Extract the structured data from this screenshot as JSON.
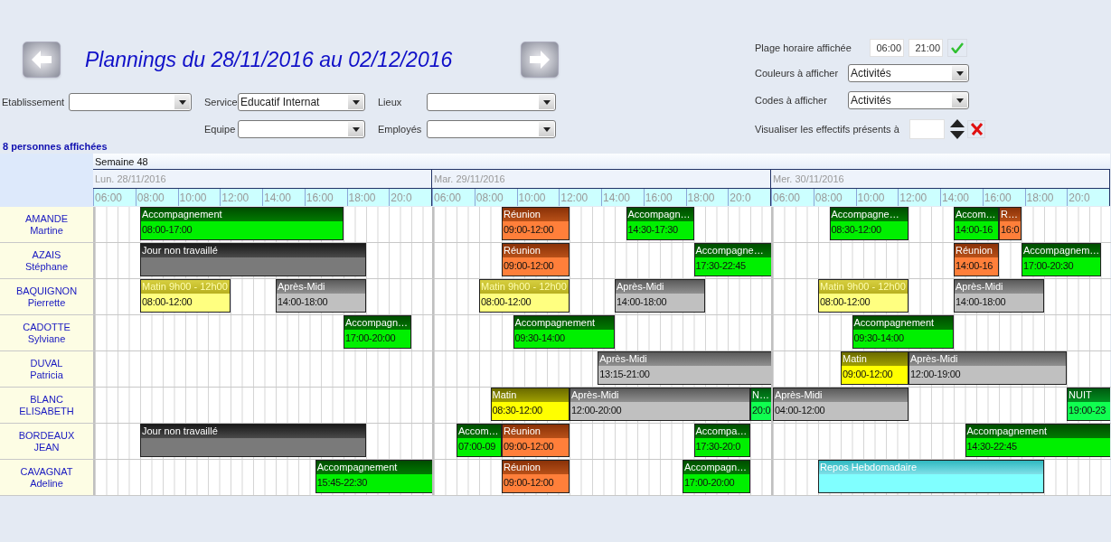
{
  "title": "Plannings du 28/11/2016 au 02/12/2016",
  "filter_rows": [
    [
      {
        "label": "Etablissement"
      },
      {
        "label": "Service",
        "value": "Educatif Internat"
      },
      {
        "label": "Lieux"
      }
    ],
    [
      {
        "label": "Equipe"
      },
      {
        "label": "Employés"
      }
    ]
  ],
  "count_label": "8 personnes affichées",
  "time_range": {
    "label": "Plage horaire affichée",
    "from": "06:00",
    "to": "21:00"
  },
  "colors_select": {
    "label": "Couleurs à afficher",
    "value": "Activités"
  },
  "codes_select": {
    "label": "Codes à afficher",
    "value": "Activités"
  },
  "presence": {
    "label": "Visualiser les effectifs présents à"
  },
  "week": "Semaine 48",
  "days": [
    {
      "label": "Lun. 28/11/2016",
      "hours": [
        "06:00",
        "08:00",
        "10:00",
        "12:00",
        "14:00",
        "16:00",
        "18:00",
        "20:0"
      ]
    },
    {
      "label": "Mar. 29/11/2016",
      "hours": [
        "06:00",
        "08:00",
        "10:00",
        "12:00",
        "14:00",
        "16:00",
        "18:00",
        "20:0"
      ]
    },
    {
      "label": "Mer. 30/11/2016",
      "hours": [
        "06:00",
        "08:00",
        "10:00",
        "12:00",
        "14:00",
        "16:00",
        "18:00",
        "20:0"
      ]
    }
  ],
  "employees": [
    {
      "last": "AMANDE",
      "first": "Martine",
      "mon": [
        {
          "kind": "accompagnement",
          "title": "Accompagnement",
          "time": "08:00-17:00"
        }
      ],
      "tue": [
        {
          "kind": "reunion",
          "title": "Réunion",
          "time": "09:00-12:00"
        },
        {
          "kind": "accompagnement",
          "title": "Accompagn…",
          "time": "14:30-17:30"
        }
      ],
      "wed": [
        {
          "kind": "accompagnement",
          "title": "Accompagne…",
          "time": "08:30-12:00"
        },
        {
          "kind": "accompagnement",
          "title": "Accom…",
          "time": "14:00-16"
        },
        {
          "kind": "reunion",
          "title": "R…",
          "time": "16:0"
        }
      ]
    },
    {
      "last": "AZAIS",
      "first": "Stéphane",
      "mon": [
        {
          "kind": "off",
          "title": "Jour non travaillé"
        }
      ],
      "tue": [
        {
          "kind": "reunion",
          "title": "Réunion",
          "time": "09:00-12:00"
        },
        {
          "kind": "accompagnement",
          "title": "Accompagne…",
          "time": "17:30-22:45"
        }
      ],
      "wed": [
        {
          "kind": "reunion",
          "title": "Réunion",
          "time": "14:00-16"
        },
        {
          "kind": "accompagnement",
          "title": "Accompagnem…",
          "time": "17:00-20:30"
        }
      ]
    },
    {
      "last": "BAQUIGNON",
      "first": "Pierrette",
      "mon": [
        {
          "kind": "matin-pale",
          "title": "Matin 9h00 - 12h00",
          "time": "08:00-12:00"
        },
        {
          "kind": "apres-midi",
          "title": "Après-Midi",
          "time": "14:00-18:00"
        }
      ],
      "tue": [
        {
          "kind": "matin-pale",
          "title": "Matin 9h00 - 12h00",
          "time": "08:00-12:00"
        },
        {
          "kind": "apres-midi",
          "title": "Après-Midi",
          "time": "14:00-18:00"
        }
      ],
      "wed": [
        {
          "kind": "matin-pale",
          "title": "Matin 9h00 - 12h00",
          "time": "08:00-12:00"
        },
        {
          "kind": "apres-midi",
          "title": "Après-Midi",
          "time": "14:00-18:00"
        }
      ]
    },
    {
      "last": "CADOTTE",
      "first": "Sylviane",
      "mon": [
        {
          "kind": "accompagnement",
          "title": "Accompagn…",
          "time": "17:00-20:00"
        }
      ],
      "tue": [
        {
          "kind": "accompagnement",
          "title": "Accompagnement",
          "time": "09:30-14:00"
        }
      ],
      "wed": [
        {
          "kind": "accompagnement",
          "title": "Accompagnement",
          "time": "09:30-14:00"
        }
      ]
    },
    {
      "last": "DUVAL",
      "first": "Patricia",
      "tue": [
        {
          "kind": "apres-midi",
          "title": "Après-Midi",
          "time": "13:15-21:00"
        }
      ],
      "wed": [
        {
          "kind": "matin",
          "title": "Matin",
          "time": "09:00-12:00"
        },
        {
          "kind": "apres-midi",
          "title": "Après-Midi",
          "time": "12:00-19:00"
        }
      ]
    },
    {
      "last": "BLANC",
      "first": "ELISABETH",
      "tue": [
        {
          "kind": "matin",
          "title": "Matin",
          "time": "08:30-12:00"
        },
        {
          "kind": "apres-midi",
          "title": "Après-Midi",
          "time": "12:00-20:00"
        },
        {
          "kind": "nuit",
          "title": "N…",
          "time": "20:0"
        }
      ],
      "wed": [
        {
          "kind": "apres-midi",
          "title": "Après-Midi",
          "time": "04:00-12:00"
        },
        {
          "kind": "nuit",
          "title": "NUIT",
          "time": "19:00-23"
        }
      ]
    },
    {
      "last": "BORDEAUX",
      "first": "JEAN",
      "mon": [
        {
          "kind": "off",
          "title": "Jour non travaillé"
        }
      ],
      "tue": [
        {
          "kind": "accompagnement",
          "title": "Accom…",
          "time": "07:00-09"
        },
        {
          "kind": "reunion",
          "title": "Réunion",
          "time": "09:00-12:00"
        },
        {
          "kind": "accompagnement",
          "title": "Accompa…",
          "time": "17:30-20:0"
        }
      ],
      "wed": [
        {
          "kind": "accompagnement",
          "title": "Accompagnement",
          "time": "14:30-22:45"
        }
      ]
    },
    {
      "last": "CAVAGNAT",
      "first": "Adeline",
      "mon": [
        {
          "kind": "accompagnement",
          "title": "Accompagnement",
          "time": "15:45-22:30"
        }
      ],
      "tue": [
        {
          "kind": "reunion",
          "title": "Réunion",
          "time": "09:00-12:00"
        },
        {
          "kind": "accompagnement",
          "title": "Accompagn…",
          "time": "17:00-20:00"
        }
      ],
      "wed": [
        {
          "kind": "repos",
          "title": "Repos Hebdomadaire"
        }
      ]
    }
  ]
}
